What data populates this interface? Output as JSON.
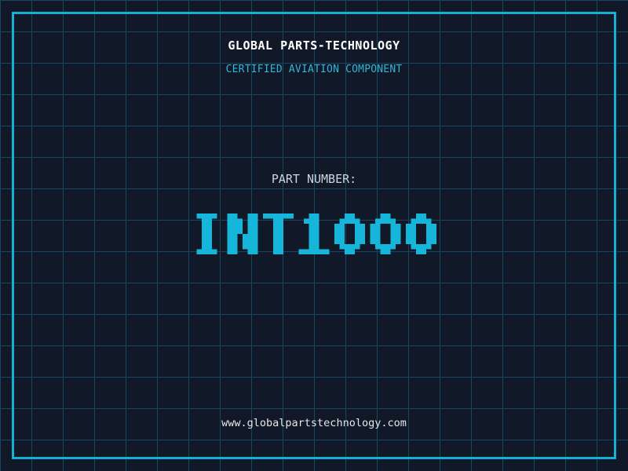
{
  "theme": {
    "background": "#111827",
    "grid_line": "#15455f",
    "frame": "#14b0d8",
    "accent": "#16b6db",
    "title_color": "#ffffff",
    "tagline_color": "#2fb6d9",
    "label_color": "#ccd4dc",
    "url_color": "#e4e7ea"
  },
  "header": {
    "company_name": "GLOBAL PARTS-TECHNOLOGY",
    "tagline": "CERTIFIED AVIATION COMPONENT"
  },
  "part_number": {
    "label": "PART NUMBER:",
    "value": "INT1000"
  },
  "footer": {
    "website": "www.globalpartstechnology.com"
  }
}
